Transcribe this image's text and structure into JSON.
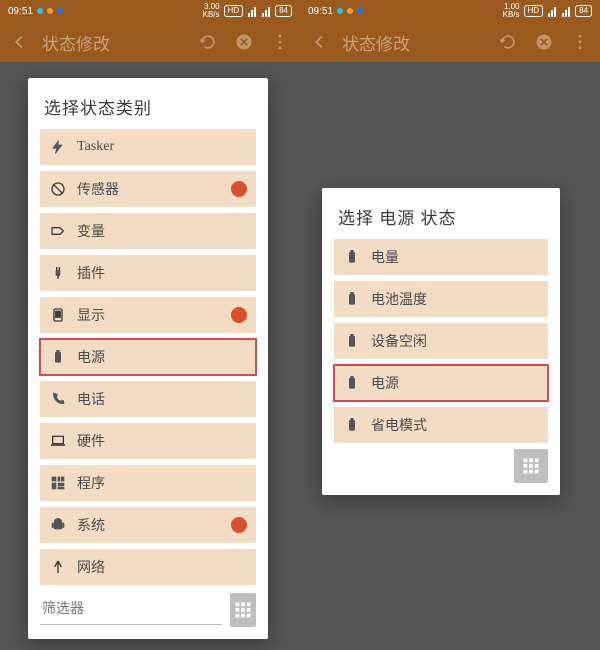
{
  "statusbar": {
    "time": "09:51",
    "kbs_left": "3.00",
    "kbs_right": "1.00",
    "kbs_unit": "KB/s",
    "hd": "HD",
    "batt": "84"
  },
  "appbar": {
    "title": "状态修改"
  },
  "left_dialog": {
    "title": "选择状态类别",
    "filter_placeholder": "筛选器",
    "items": [
      {
        "icon": "bolt",
        "label": "Tasker",
        "badge": false,
        "hl": false
      },
      {
        "icon": "sensor",
        "label": "传感器",
        "badge": true,
        "hl": false
      },
      {
        "icon": "tag",
        "label": "变量",
        "badge": false,
        "hl": false
      },
      {
        "icon": "plug",
        "label": "插件",
        "badge": false,
        "hl": false
      },
      {
        "icon": "display",
        "label": "显示",
        "badge": true,
        "hl": false
      },
      {
        "icon": "battery",
        "label": "电源",
        "badge": false,
        "hl": true
      },
      {
        "icon": "phone",
        "label": "电话",
        "badge": false,
        "hl": false
      },
      {
        "icon": "laptop",
        "label": "硬件",
        "badge": false,
        "hl": false
      },
      {
        "icon": "apps",
        "label": "程序",
        "badge": false,
        "hl": false
      },
      {
        "icon": "android",
        "label": "系统",
        "badge": true,
        "hl": false
      },
      {
        "icon": "net",
        "label": "网络",
        "badge": false,
        "hl": false
      }
    ]
  },
  "right_dialog": {
    "title": "选择 电源 状态",
    "items": [
      {
        "icon": "battery",
        "label": "电量",
        "hl": false
      },
      {
        "icon": "battery",
        "label": "电池温度",
        "hl": false
      },
      {
        "icon": "battery",
        "label": "设备空闲",
        "hl": false
      },
      {
        "icon": "battery",
        "label": "电源",
        "hl": true
      },
      {
        "icon": "battery",
        "label": "省电模式",
        "hl": false
      }
    ]
  }
}
